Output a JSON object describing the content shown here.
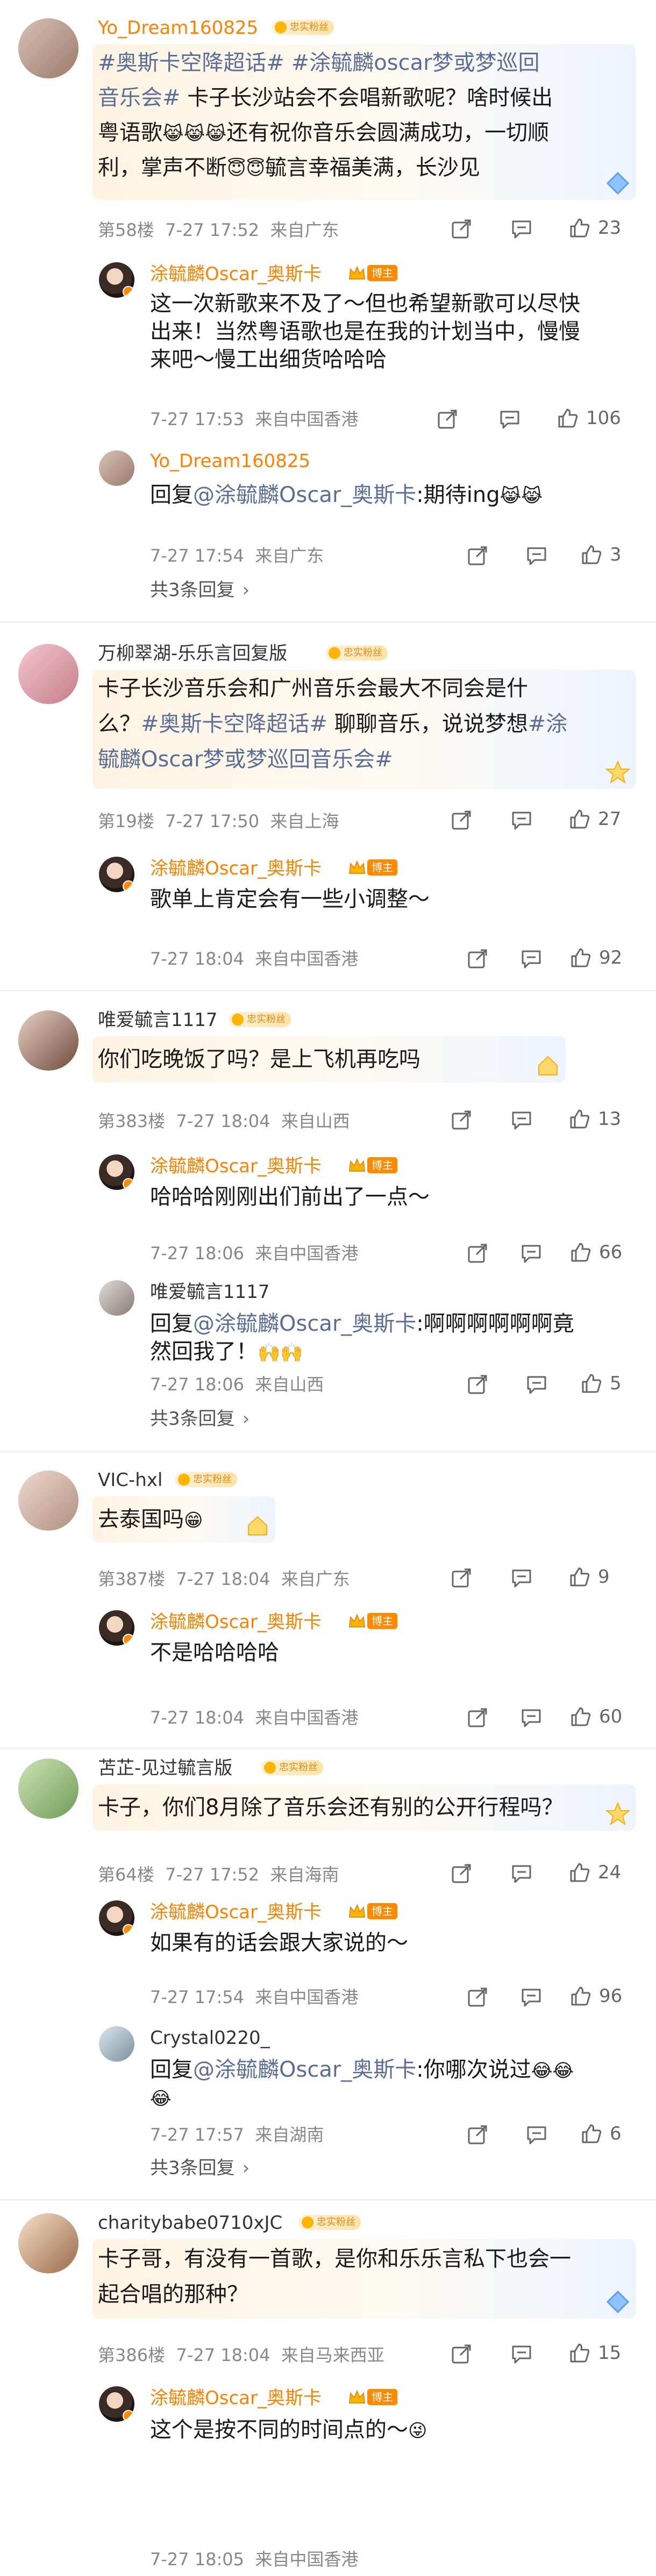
{
  "colors": {
    "orange_name": "#ff8200",
    "topic_blue": "#5a6e98",
    "meta_gray": "#888888",
    "fan_badge_text": "#e58c1a",
    "boss_badge_bg": "#ff8a00"
  },
  "icons": {
    "share": "share-icon",
    "comment": "comment-icon",
    "like": "thumbs-up-icon",
    "fan_badge": "fan-badge-icon",
    "blogger_badge": "blogger-crown-icon"
  },
  "c1": {
    "user": "Yo_Dream160825",
    "badge": "忠实粉丝",
    "line1_tag1": "#奥斯卡空降超话#",
    "line1_tag2": "#涂毓麟oscar梦或梦巡回",
    "line2_tag": "音乐会#",
    "line2_rest": " 卡子长沙站会不会唱新歌呢？啥时候出",
    "line3a": "粤语歌",
    "line3b": "还有祝你音乐会圆满成功，一切顺",
    "line4a": "利，掌声不断",
    "line4b": "毓言幸福美满，长沙见",
    "floor": "第58楼",
    "time": "7-27 17:52",
    "from": "来自广东",
    "likes": "23",
    "r1": {
      "user": "涂毓麟Oscar_奥斯卡",
      "boss": "博主",
      "line1": "这一次新歌来不及了～但也希望新歌可以尽快",
      "line2": "出来！当然粤语歌也是在我的计划当中，慢慢",
      "line3": "来吧～慢工出细货哈哈哈",
      "time": "7-27 17:53",
      "from": "来自中国香港",
      "likes": "106"
    },
    "r2": {
      "user": "Yo_Dream160825",
      "prefix": "回复",
      "mention": "@涂毓麟Oscar_奥斯卡",
      "content": ":期待ing",
      "time": "7-27 17:54",
      "from": "来自广东",
      "likes": "3"
    },
    "more": "共3条回复"
  },
  "c2": {
    "user": "万柳翠湖-乐乐言回复版",
    "badge": "忠实粉丝",
    "line1": "卡子长沙音乐会和广州音乐会最大不同会是什",
    "line2a": "么？",
    "line2_tag": "#奥斯卡空降超话#",
    "line2b": " 聊聊音乐，说说梦想",
    "line2_tag2": "#涂",
    "line3_tag": "毓麟Oscar梦或梦巡回音乐会#",
    "floor": "第19楼",
    "time": "7-27 17:50",
    "from": "来自上海",
    "likes": "27",
    "r1": {
      "user": "涂毓麟Oscar_奥斯卡",
      "boss": "博主",
      "line1": "歌单上肯定会有一些小调整～",
      "time": "7-27 18:04",
      "from": "来自中国香港",
      "likes": "92"
    }
  },
  "c3": {
    "user": "唯爱毓言1117",
    "badge": "忠实粉丝",
    "line1": "你们吃晚饭了吗？是上飞机再吃吗",
    "floor": "第383楼",
    "time": "7-27 18:04",
    "from": "来自山西",
    "likes": "13",
    "r1": {
      "user": "涂毓麟Oscar_奥斯卡",
      "boss": "博主",
      "line1": "哈哈哈刚刚出们前出了一点～",
      "time": "7-27 18:06",
      "from": "来自中国香港",
      "likes": "66"
    },
    "r2": {
      "user": "唯爱毓言1117",
      "prefix": "回复",
      "mention": "@涂毓麟Oscar_奥斯卡",
      "content": ":啊啊啊啊啊啊竟",
      "line2": "然回我了！",
      "time": "7-27 18:06",
      "from": "来自山西",
      "likes": "5"
    },
    "more": "共3条回复"
  },
  "c4": {
    "user": "VIC-hxl",
    "badge": "忠实粉丝",
    "line1": "去泰国吗",
    "floor": "第387楼",
    "time": "7-27 18:04",
    "from": "来自广东",
    "likes": "9",
    "r1": {
      "user": "涂毓麟Oscar_奥斯卡",
      "boss": "博主",
      "line1": "不是哈哈哈哈",
      "time": "7-27 18:04",
      "from": "来自中国香港",
      "likes": "60"
    }
  },
  "c5": {
    "user": "苫芷-见过毓言版",
    "badge": "忠实粉丝",
    "line1": "卡子，你们8月除了音乐会还有别的公开行程吗？",
    "floor": "第64楼",
    "time": "7-27 17:52",
    "from": "来自海南",
    "likes": "24",
    "r1": {
      "user": "涂毓麟Oscar_奥斯卡",
      "boss": "博主",
      "line1": "如果有的话会跟大家说的～",
      "time": "7-27 17:54",
      "from": "来自中国香港",
      "likes": "96"
    },
    "r2": {
      "user": "Crystal0220_",
      "prefix": "回复",
      "mention": "@涂毓麟Oscar_奥斯卡",
      "content": ":你哪次说过",
      "time": "7-27 17:57",
      "from": "来自湖南",
      "likes": "6"
    },
    "more": "共3条回复"
  },
  "c6": {
    "user": "charitybabe0710xJC",
    "badge": "忠实粉丝",
    "line1": "卡子哥，有没有一首歌，是你和乐乐言私下也会一",
    "line2": "起合唱的那种？",
    "floor": "第386楼",
    "time": "7-27 18:04",
    "from": "来自马来西亚",
    "likes": "15",
    "r1": {
      "user": "涂毓麟Oscar_奥斯卡",
      "boss": "博主",
      "line1": "这个是按不同的时间点的～",
      "time": "7-27 18:05",
      "from": "来自中国香港"
    }
  }
}
